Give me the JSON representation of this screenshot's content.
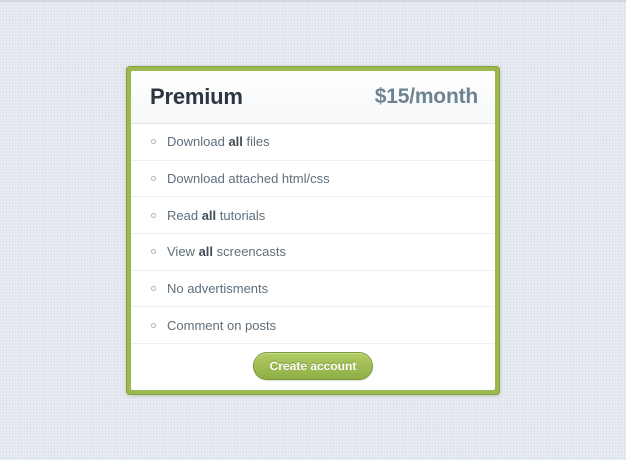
{
  "plan": {
    "name": "Premium",
    "price": "$15/month"
  },
  "features": [
    {
      "before": "Download ",
      "bold": "all",
      "after": " files"
    },
    {
      "before": "Download attached html/css",
      "bold": "",
      "after": ""
    },
    {
      "before": "Read ",
      "bold": "all",
      "after": " tutorials"
    },
    {
      "before": "View ",
      "bold": "all",
      "after": " screencasts"
    },
    {
      "before": "No advertisments",
      "bold": "",
      "after": ""
    },
    {
      "before": "Comment on posts",
      "bold": "",
      "after": ""
    }
  ],
  "footer": {
    "button_label": "Create account"
  },
  "icons": {
    "bullet": "circle-bullet-icon"
  },
  "colors": {
    "accent": "#9bb94f",
    "button_top": "#b0cd63",
    "button_bottom": "#8fae45",
    "title": "#2c3540",
    "price": "#6e8391",
    "feature_text": "#5f6f7c",
    "background": "#e4e9f0"
  }
}
